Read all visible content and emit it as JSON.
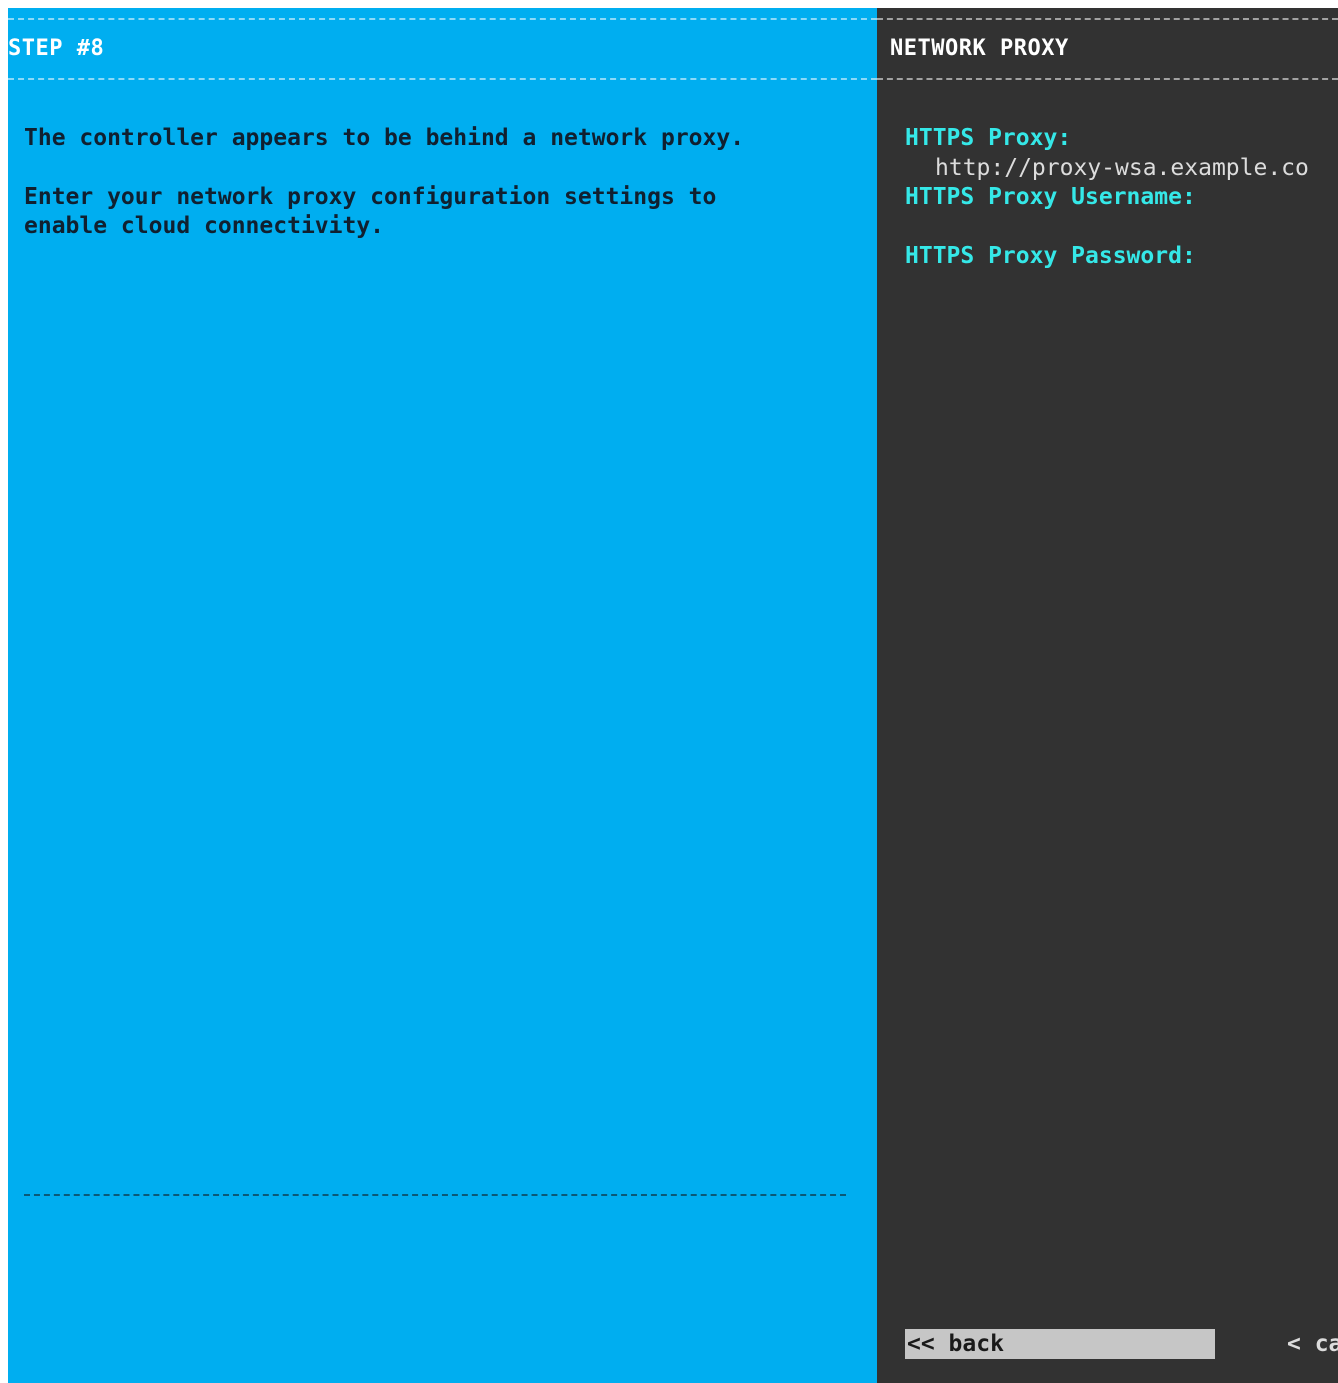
{
  "step_panel": {
    "title": "STEP #8",
    "message_line1": "The controller appears to be behind a network proxy.",
    "message_line2": "Enter your network proxy configuration settings to",
    "message_line3": "enable cloud connectivity.",
    "background_color": "#00aef0"
  },
  "form_panel": {
    "title": "NETWORK PROXY",
    "background_color": "#323232",
    "label_color": "#35e8e8",
    "fields": [
      {
        "label": "HTTPS Proxy:",
        "value": "http://proxy-wsa.example.co"
      },
      {
        "label": "HTTPS Proxy Username:",
        "value": ""
      },
      {
        "label": "HTTPS Proxy Password:",
        "value": ""
      }
    ],
    "buttons": {
      "back_label": "<< back",
      "cancel_label": "< ca"
    }
  }
}
